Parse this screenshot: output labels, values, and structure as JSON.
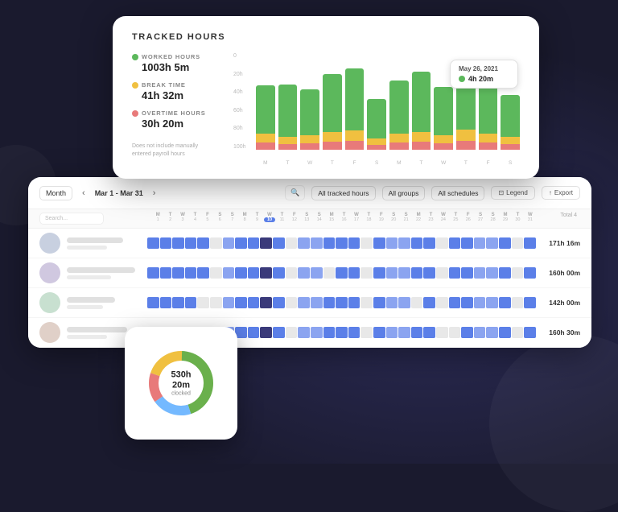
{
  "background": "#1a1a2e",
  "tracked_card": {
    "title": "TRACKED HOURS",
    "legend": [
      {
        "key": "worked",
        "label": "WORKED HOURS",
        "value": "1003h 5m",
        "color": "#5cb85c"
      },
      {
        "key": "break",
        "label": "BREAK TIME",
        "value": "41h 32m",
        "color": "#f0c040"
      },
      {
        "key": "overtime",
        "label": "OVERTIME HOURS",
        "value": "30h 20m",
        "color": "#e87a7a"
      }
    ],
    "note": "Does not include manually entered payroll hours",
    "y_labels": [
      "100h",
      "80h",
      "60h",
      "40h",
      "20h",
      "0"
    ],
    "x_labels": [
      "M",
      "T",
      "W",
      "T",
      "F",
      "S",
      "M",
      "T",
      "W",
      "T",
      "F",
      "S"
    ],
    "bars": [
      {
        "green": 55,
        "yellow": 10,
        "pink": 8
      },
      {
        "green": 60,
        "yellow": 8,
        "pink": 6
      },
      {
        "green": 52,
        "yellow": 9,
        "pink": 7
      },
      {
        "green": 65,
        "yellow": 11,
        "pink": 9
      },
      {
        "green": 70,
        "yellow": 12,
        "pink": 10
      },
      {
        "green": 45,
        "yellow": 7,
        "pink": 5
      },
      {
        "green": 60,
        "yellow": 10,
        "pink": 8
      },
      {
        "green": 68,
        "yellow": 11,
        "pink": 9
      },
      {
        "green": 55,
        "yellow": 9,
        "pink": 7
      },
      {
        "green": 72,
        "yellow": 13,
        "pink": 10
      },
      {
        "green": 62,
        "yellow": 10,
        "pink": 8
      },
      {
        "green": 48,
        "yellow": 8,
        "pink": 6
      }
    ],
    "tooltip": {
      "date": "May 26, 2021",
      "value": "4h 20m",
      "color": "#5cb85c"
    }
  },
  "table_card": {
    "toolbar": {
      "period_label": "Month",
      "date_range": "Mar 1 - Mar 31",
      "filters": [
        {
          "label": "All tracked hours",
          "key": "hours-filter"
        },
        {
          "label": "All groups",
          "key": "groups-filter"
        },
        {
          "label": "All schedules",
          "key": "schedules-filter"
        }
      ],
      "legend_btn": "Legend",
      "export_btn": "Export"
    },
    "search_placeholder": "Search...",
    "total_label": "Total 4",
    "rows": [
      {
        "total": "171h 16m",
        "pattern": [
          1,
          1,
          1,
          1,
          1,
          0,
          1,
          1,
          1,
          1,
          1,
          0,
          1,
          1,
          1,
          1,
          1,
          0,
          1,
          1,
          1,
          1,
          1,
          0,
          1,
          1,
          1,
          1,
          1,
          0,
          1
        ]
      },
      {
        "total": "160h 00m",
        "pattern": [
          1,
          1,
          1,
          1,
          1,
          0,
          1,
          1,
          1,
          1,
          1,
          0,
          1,
          1,
          0,
          1,
          1,
          0,
          1,
          1,
          1,
          1,
          1,
          0,
          1,
          1,
          1,
          1,
          1,
          0,
          1
        ]
      },
      {
        "total": "142h 00m",
        "pattern": [
          1,
          1,
          1,
          1,
          0,
          0,
          1,
          1,
          1,
          1,
          1,
          0,
          1,
          1,
          1,
          1,
          1,
          0,
          1,
          1,
          1,
          0,
          1,
          0,
          1,
          1,
          1,
          1,
          1,
          0,
          1
        ]
      },
      {
        "total": "160h 30m",
        "pattern": [
          1,
          1,
          1,
          1,
          1,
          0,
          1,
          1,
          1,
          1,
          1,
          0,
          1,
          1,
          1,
          1,
          1,
          0,
          1,
          1,
          1,
          1,
          1,
          0,
          0,
          1,
          1,
          1,
          1,
          0,
          1
        ]
      }
    ],
    "day_headers": [
      "M",
      "T",
      "W",
      "T",
      "F",
      "S",
      "S",
      "M",
      "T",
      "W",
      "T",
      "F",
      "S",
      "S",
      "M",
      "T",
      "W",
      "T",
      "F",
      "S",
      "S",
      "M",
      "T",
      "W",
      "T",
      "F",
      "S",
      "S",
      "M",
      "T",
      "W"
    ],
    "day_nums": [
      "1",
      "2",
      "3",
      "4",
      "5",
      "6",
      "7",
      "8",
      "9",
      "10",
      "11",
      "12",
      "13",
      "14",
      "15",
      "16",
      "17",
      "18",
      "19",
      "20",
      "21",
      "22",
      "23",
      "24",
      "25",
      "26",
      "27",
      "28",
      "29",
      "30",
      "31"
    ]
  },
  "donut_card": {
    "value": "530h 20m",
    "sub_label": "clocked",
    "segments": [
      {
        "color": "#e87a7a",
        "pct": 15
      },
      {
        "color": "#f0c040",
        "pct": 20
      },
      {
        "color": "#6ab04c",
        "pct": 45
      },
      {
        "color": "#74b9ff",
        "pct": 20
      }
    ]
  }
}
